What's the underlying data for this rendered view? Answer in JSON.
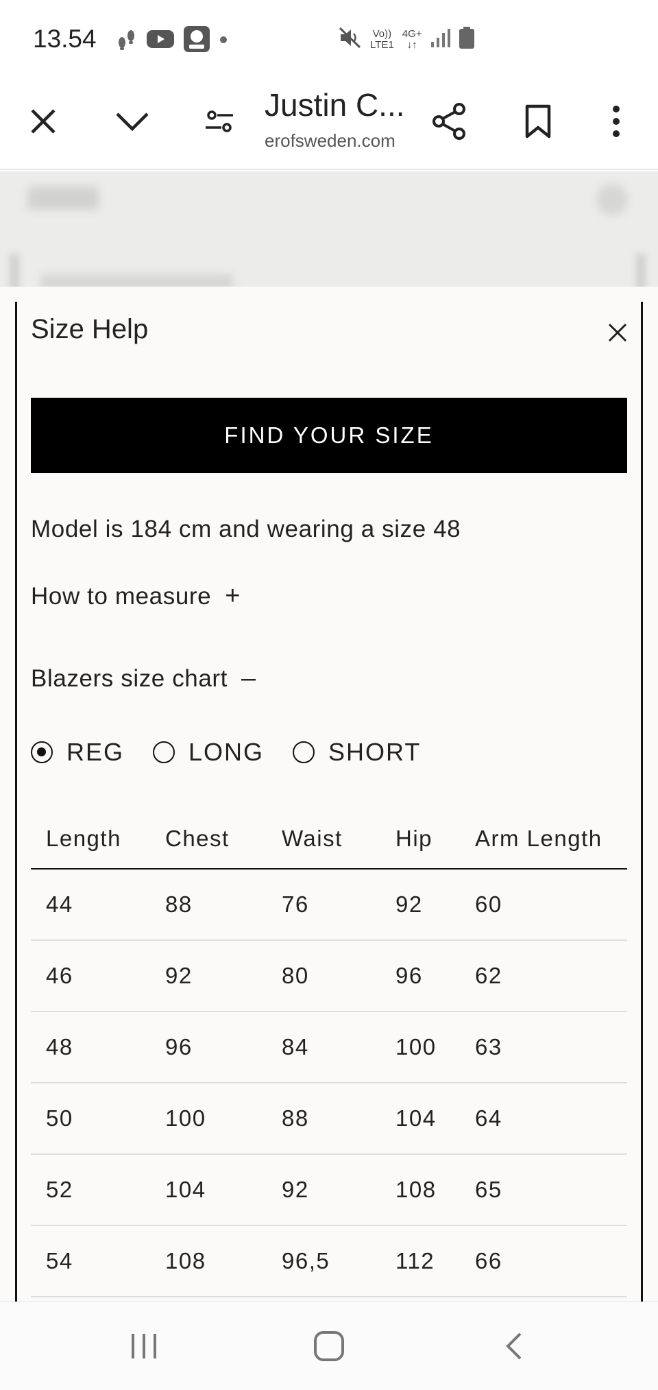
{
  "status_bar": {
    "time": "13.54",
    "network_top": "Vo))",
    "network_bottom": "LTE1",
    "network_type": "4G+"
  },
  "browser": {
    "page_title": "Justin C...",
    "domain": "erofsweden.com"
  },
  "panel": {
    "title": "Size Help",
    "find_size_label": "FIND YOUR SIZE",
    "model_info": "Model is 184 cm and wearing a size 48",
    "how_to_measure": {
      "label": "How to measure",
      "toggle": "+"
    },
    "size_chart": {
      "label": "Blazers size chart",
      "toggle": "–"
    },
    "fits": [
      {
        "label": "REG",
        "selected": true
      },
      {
        "label": "LONG",
        "selected": false
      },
      {
        "label": "SHORT",
        "selected": false
      }
    ],
    "table": {
      "headers": [
        "Length",
        "Chest",
        "Waist",
        "Hip",
        "Arm Length"
      ],
      "rows": [
        [
          "44",
          "88",
          "76",
          "92",
          "60"
        ],
        [
          "46",
          "92",
          "80",
          "96",
          "62"
        ],
        [
          "48",
          "96",
          "84",
          "100",
          "63"
        ],
        [
          "50",
          "100",
          "88",
          "104",
          "64"
        ],
        [
          "52",
          "104",
          "92",
          "108",
          "65"
        ],
        [
          "54",
          "108",
          "96,5",
          "112",
          "66"
        ]
      ]
    }
  }
}
